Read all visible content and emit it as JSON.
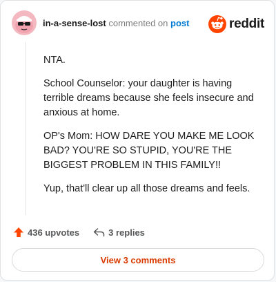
{
  "comment": {
    "username": "in-a-sense-lost",
    "action_text": "commented on",
    "post_link": "post",
    "paragraphs": [
      "NTA.",
      "School Counselor: your daughter is having terrible dreams because she feels insecure and anxious at home.",
      "OP's Mom: HOW DARE YOU MAKE ME LOOK BAD? YOU'RE SO STUPID, YOU'RE THE BIGGEST PROBLEM IN THIS FAMILY!!",
      "Yup, that'll clear up all those dreams and feels."
    ]
  },
  "brand": {
    "name": "reddit",
    "logo_icon": "reddit-snoo-icon",
    "accent_color": "#ff4500"
  },
  "actions": {
    "upvotes_label": "436 upvotes",
    "replies_label": "3 replies"
  },
  "footer": {
    "view_comments_label": "View 3 comments"
  },
  "colors": {
    "link": "#0079d3",
    "upvote": "#ff4500",
    "button_text": "#d93a00"
  }
}
